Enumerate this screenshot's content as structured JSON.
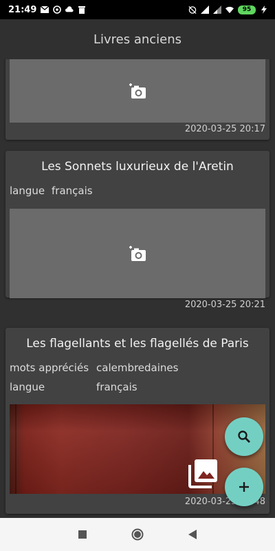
{
  "status_bar": {
    "time": "21:49",
    "left_icons": [
      "gmail-icon",
      "sync-icon",
      "cloud-icon",
      "trash-icon"
    ],
    "right_icons": [
      "alarm-off-icon",
      "signal-icon",
      "signal-icon",
      "wifi-icon"
    ],
    "battery": "95"
  },
  "app_bar": {
    "title": "Livres anciens"
  },
  "cards": [
    {
      "timestamp": "2020-03-25 20:17"
    },
    {
      "title": "Les Sonnets luxurieux de l'Aretin",
      "fields": [
        {
          "key": "langue",
          "value": "français"
        }
      ],
      "timestamp": "2020-03-25 20:21"
    },
    {
      "title": "Les flagellants et les flagellés de Paris",
      "fields": [
        {
          "key": "mots appréciés",
          "value": "calembredaines"
        },
        {
          "key": "langue",
          "value": "français"
        }
      ],
      "timestamp": "2020-03-25 20:48"
    }
  ],
  "fabs": {
    "search": "search-icon",
    "add": "add-icon"
  },
  "nav_bar": {
    "buttons": [
      "recents-square",
      "home-circle",
      "back-triangle"
    ]
  },
  "colors": {
    "fab": "#74cfc3",
    "card": "#424242",
    "background": "#303030",
    "photo_placeholder": "#6b6b6b"
  }
}
